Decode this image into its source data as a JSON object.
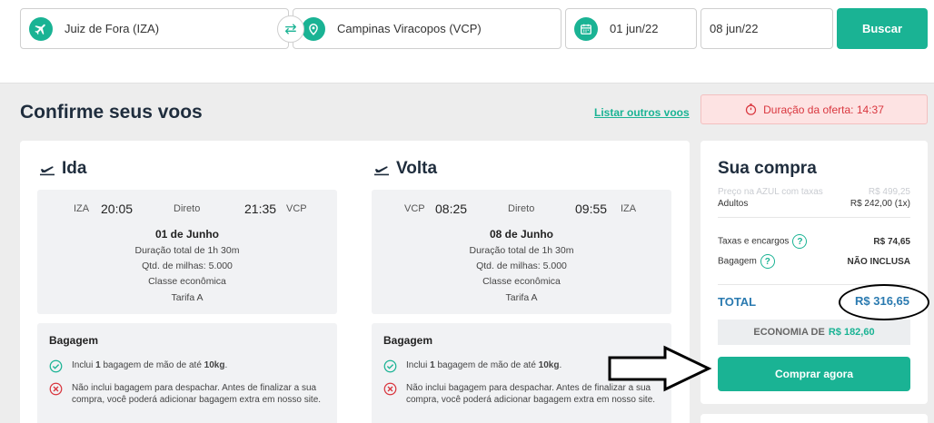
{
  "search": {
    "origin": "Juiz de Fora (IZA)",
    "destination": "Campinas Viracopos (VCP)",
    "depart_date": "01 jun/22",
    "return_date": "08 jun/22",
    "search_button": "Buscar"
  },
  "header": {
    "title": "Confirme seus voos",
    "list_other": "Listar outros voos",
    "offer_label": "Duração da oferta: 14:37"
  },
  "outbound": {
    "title": "Ida",
    "from": "IZA",
    "depart_time": "20:05",
    "stops": "Direto",
    "arrive_time": "21:35",
    "to": "VCP",
    "date": "01 de Junho",
    "duration": "Duração total de 1h 30m",
    "miles": "Qtd. de milhas: 5.000",
    "cabin": "Classe econômica",
    "fare": "Tarifa A"
  },
  "inbound": {
    "title": "Volta",
    "from": "VCP",
    "depart_time": "08:25",
    "stops": "Direto",
    "arrive_time": "09:55",
    "to": "IZA",
    "date": "08 de Junho",
    "duration": "Duração total de 1h 30m",
    "miles": "Qtd. de milhas: 5.000",
    "cabin": "Classe econômica",
    "fare": "Tarifa A"
  },
  "baggage": {
    "title": "Bagagem",
    "line1_pre": "Inclui ",
    "line1_qty": "1",
    "line1_mid": " bagagem de mão de até ",
    "line1_weight": "10kg",
    "line1_end": ".",
    "line2": "Não inclui bagagem para despachar. Antes de finalizar a sua compra, você poderá adicionar bagagem extra em nosso site."
  },
  "summary": {
    "title": "Sua compra",
    "azul_label": "Preço na AZUL com taxas",
    "azul_value": "R$ 499,25",
    "adults_label": "Adultos",
    "adults_value": "R$ 242,00 (1x)",
    "taxes_label": "Taxas e encargos",
    "taxes_value": "R$ 74,65",
    "bag_label": "Bagagem",
    "bag_value": "NÃO INCLUSA",
    "total_label": "TOTAL",
    "total_value": "R$ 316,65",
    "economy_label": "ECONOMIA DE",
    "economy_value": "R$ 182,60",
    "buy_button": "Comprar agora"
  },
  "colors": {
    "accent": "#1ab394",
    "total": "#2a7ab0",
    "offer": "#d9363e"
  }
}
